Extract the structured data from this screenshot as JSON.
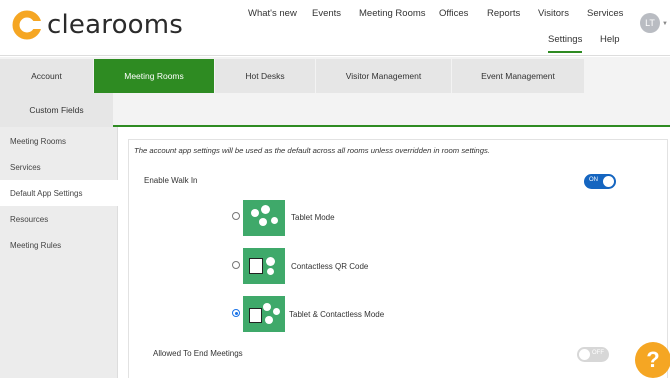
{
  "brand": {
    "name": "clearooms",
    "accent": "#2e8b22",
    "logo_color": "#f5a623"
  },
  "nav": {
    "top": [
      "What's new",
      "Events",
      "Meeting Rooms",
      "Offices",
      "Reports",
      "Visitors",
      "Services"
    ],
    "settings": "Settings",
    "help": "Help",
    "user_initials": "LT"
  },
  "tabs": [
    "Account",
    "Meeting Rooms",
    "Hot Desks",
    "Visitor Management",
    "Event Management",
    "Custom Fields"
  ],
  "active_tab": "Meeting Rooms",
  "sidebar": {
    "items": [
      "Meeting Rooms",
      "Services",
      "Default App Settings",
      "Resources",
      "Meeting Rules"
    ],
    "active": "Default App Settings"
  },
  "content": {
    "info": "The account app settings will be used as the default across all rooms unless overridden in room settings.",
    "enable_walk_in": {
      "label": "Enable Walk In",
      "state": "ON"
    },
    "modes": [
      {
        "label": "Tablet Mode",
        "selected": false,
        "icon": "tablet-mode-icon"
      },
      {
        "label": "Contactless QR Code",
        "selected": false,
        "icon": "qr-code-icon"
      },
      {
        "label": "Tablet & Contactless Mode",
        "selected": true,
        "icon": "tablet-contactless-icon"
      }
    ],
    "allowed_to_end": {
      "label": "Allowed To End Meetings",
      "state": "OFF"
    }
  },
  "help_button": "?"
}
